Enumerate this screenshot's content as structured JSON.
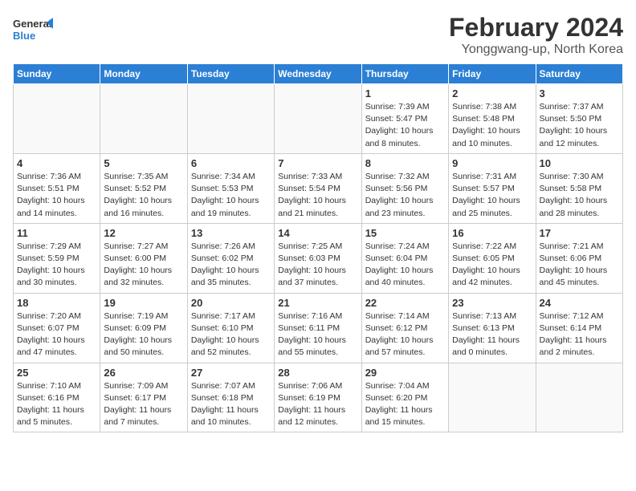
{
  "header": {
    "logo_general": "General",
    "logo_blue": "Blue",
    "month": "February 2024",
    "location": "Yonggwang-up, North Korea"
  },
  "days_of_week": [
    "Sunday",
    "Monday",
    "Tuesday",
    "Wednesday",
    "Thursday",
    "Friday",
    "Saturday"
  ],
  "weeks": [
    [
      {
        "day": "",
        "info": ""
      },
      {
        "day": "",
        "info": ""
      },
      {
        "day": "",
        "info": ""
      },
      {
        "day": "",
        "info": ""
      },
      {
        "day": "1",
        "info": "Sunrise: 7:39 AM\nSunset: 5:47 PM\nDaylight: 10 hours\nand 8 minutes."
      },
      {
        "day": "2",
        "info": "Sunrise: 7:38 AM\nSunset: 5:48 PM\nDaylight: 10 hours\nand 10 minutes."
      },
      {
        "day": "3",
        "info": "Sunrise: 7:37 AM\nSunset: 5:50 PM\nDaylight: 10 hours\nand 12 minutes."
      }
    ],
    [
      {
        "day": "4",
        "info": "Sunrise: 7:36 AM\nSunset: 5:51 PM\nDaylight: 10 hours\nand 14 minutes."
      },
      {
        "day": "5",
        "info": "Sunrise: 7:35 AM\nSunset: 5:52 PM\nDaylight: 10 hours\nand 16 minutes."
      },
      {
        "day": "6",
        "info": "Sunrise: 7:34 AM\nSunset: 5:53 PM\nDaylight: 10 hours\nand 19 minutes."
      },
      {
        "day": "7",
        "info": "Sunrise: 7:33 AM\nSunset: 5:54 PM\nDaylight: 10 hours\nand 21 minutes."
      },
      {
        "day": "8",
        "info": "Sunrise: 7:32 AM\nSunset: 5:56 PM\nDaylight: 10 hours\nand 23 minutes."
      },
      {
        "day": "9",
        "info": "Sunrise: 7:31 AM\nSunset: 5:57 PM\nDaylight: 10 hours\nand 25 minutes."
      },
      {
        "day": "10",
        "info": "Sunrise: 7:30 AM\nSunset: 5:58 PM\nDaylight: 10 hours\nand 28 minutes."
      }
    ],
    [
      {
        "day": "11",
        "info": "Sunrise: 7:29 AM\nSunset: 5:59 PM\nDaylight: 10 hours\nand 30 minutes."
      },
      {
        "day": "12",
        "info": "Sunrise: 7:27 AM\nSunset: 6:00 PM\nDaylight: 10 hours\nand 32 minutes."
      },
      {
        "day": "13",
        "info": "Sunrise: 7:26 AM\nSunset: 6:02 PM\nDaylight: 10 hours\nand 35 minutes."
      },
      {
        "day": "14",
        "info": "Sunrise: 7:25 AM\nSunset: 6:03 PM\nDaylight: 10 hours\nand 37 minutes."
      },
      {
        "day": "15",
        "info": "Sunrise: 7:24 AM\nSunset: 6:04 PM\nDaylight: 10 hours\nand 40 minutes."
      },
      {
        "day": "16",
        "info": "Sunrise: 7:22 AM\nSunset: 6:05 PM\nDaylight: 10 hours\nand 42 minutes."
      },
      {
        "day": "17",
        "info": "Sunrise: 7:21 AM\nSunset: 6:06 PM\nDaylight: 10 hours\nand 45 minutes."
      }
    ],
    [
      {
        "day": "18",
        "info": "Sunrise: 7:20 AM\nSunset: 6:07 PM\nDaylight: 10 hours\nand 47 minutes."
      },
      {
        "day": "19",
        "info": "Sunrise: 7:19 AM\nSunset: 6:09 PM\nDaylight: 10 hours\nand 50 minutes."
      },
      {
        "day": "20",
        "info": "Sunrise: 7:17 AM\nSunset: 6:10 PM\nDaylight: 10 hours\nand 52 minutes."
      },
      {
        "day": "21",
        "info": "Sunrise: 7:16 AM\nSunset: 6:11 PM\nDaylight: 10 hours\nand 55 minutes."
      },
      {
        "day": "22",
        "info": "Sunrise: 7:14 AM\nSunset: 6:12 PM\nDaylight: 10 hours\nand 57 minutes."
      },
      {
        "day": "23",
        "info": "Sunrise: 7:13 AM\nSunset: 6:13 PM\nDaylight: 11 hours\nand 0 minutes."
      },
      {
        "day": "24",
        "info": "Sunrise: 7:12 AM\nSunset: 6:14 PM\nDaylight: 11 hours\nand 2 minutes."
      }
    ],
    [
      {
        "day": "25",
        "info": "Sunrise: 7:10 AM\nSunset: 6:16 PM\nDaylight: 11 hours\nand 5 minutes."
      },
      {
        "day": "26",
        "info": "Sunrise: 7:09 AM\nSunset: 6:17 PM\nDaylight: 11 hours\nand 7 minutes."
      },
      {
        "day": "27",
        "info": "Sunrise: 7:07 AM\nSunset: 6:18 PM\nDaylight: 11 hours\nand 10 minutes."
      },
      {
        "day": "28",
        "info": "Sunrise: 7:06 AM\nSunset: 6:19 PM\nDaylight: 11 hours\nand 12 minutes."
      },
      {
        "day": "29",
        "info": "Sunrise: 7:04 AM\nSunset: 6:20 PM\nDaylight: 11 hours\nand 15 minutes."
      },
      {
        "day": "",
        "info": ""
      },
      {
        "day": "",
        "info": ""
      }
    ]
  ]
}
